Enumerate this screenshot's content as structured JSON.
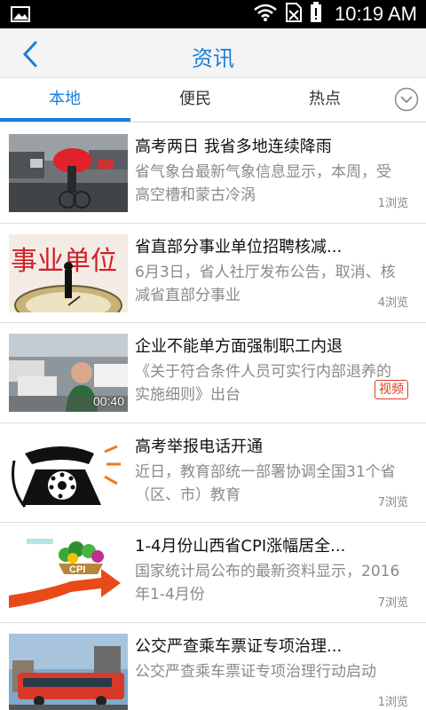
{
  "status_bar": {
    "time": "10:19 AM"
  },
  "header": {
    "title": "资讯",
    "back_icon": "chevron-left-icon"
  },
  "tabs": [
    {
      "label": "本地",
      "active": true
    },
    {
      "label": "便民",
      "active": false
    },
    {
      "label": "热点",
      "active": false
    }
  ],
  "tab_more_icon": "chevron-down-circle-icon",
  "news": [
    {
      "title": "高考两日 我省多地连续降雨",
      "summary": "省气象台最新气象信息显示，本周，受高空槽和蒙古冷涡",
      "views": "1浏览"
    },
    {
      "title": "省直部分事业单位招聘核减...",
      "summary": "6月3日，省人社厅发布公告，取消、核减省直部分事业",
      "views": "4浏览",
      "thumb_text": "事业单位"
    },
    {
      "title": "企业不能单方面强制职工内退",
      "summary": "《关于符合条件人员可实行内部退养的实施细则》出台",
      "badge": "视频",
      "duration": "00:40"
    },
    {
      "title": "高考举报电话开通",
      "summary": "近日，教育部统一部署协调全国31个省（区、市）教育",
      "views": "7浏览"
    },
    {
      "title": "1-4月份山西省CPI涨幅居全...",
      "summary": "国家统计局公布的最新资料显示，2016年1-4月份",
      "views": "7浏览",
      "thumb_text": "CPI"
    },
    {
      "title": "公交严查乘车票证专项治理...",
      "summary": "公交严查乘车票证专项治理行动启动",
      "views": "1浏览"
    }
  ],
  "colors": {
    "accent": "#1a7fd8",
    "badge": "#e23b1f",
    "status_bar": "#000000"
  }
}
